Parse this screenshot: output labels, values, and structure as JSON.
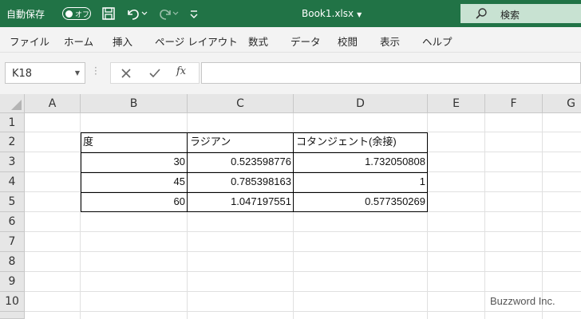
{
  "titlebar": {
    "autosave_label": "自動保存",
    "autosave_state": "オフ",
    "document_title": "Book1.xlsx",
    "search_placeholder": "検索",
    "icons": [
      "save-icon",
      "undo-icon",
      "redo-icon",
      "customize-icon",
      "search-icon"
    ]
  },
  "menu": {
    "items": [
      "ファイル",
      "ホーム",
      "挿入",
      "ページ レイアウト",
      "数式",
      "データ",
      "校閲",
      "表示",
      "ヘルプ"
    ]
  },
  "formula_bar": {
    "name_box": "K18",
    "fx_label": "fx",
    "value": ""
  },
  "sheet": {
    "columns": [
      "A",
      "B",
      "C",
      "D",
      "E",
      "F",
      "G"
    ],
    "rows": [
      "1",
      "2",
      "3",
      "4",
      "5",
      "6",
      "7",
      "8",
      "9",
      "10"
    ],
    "table": {
      "headers": [
        "度",
        "ラジアン",
        "コタンジェント(余接)"
      ],
      "rows": [
        [
          "30",
          "0.523598776",
          "1.732050808"
        ],
        [
          "45",
          "0.785398163",
          "1"
        ],
        [
          "60",
          "1.047197551",
          "0.577350269"
        ]
      ]
    }
  },
  "watermark": "Buzzword Inc.",
  "colors": {
    "titlebar": "#217346",
    "search_bg": "#c8e2d2",
    "menubar": "#f3f3f3",
    "header_bg": "#e6e6e6",
    "gridline": "#e0e0e0"
  }
}
